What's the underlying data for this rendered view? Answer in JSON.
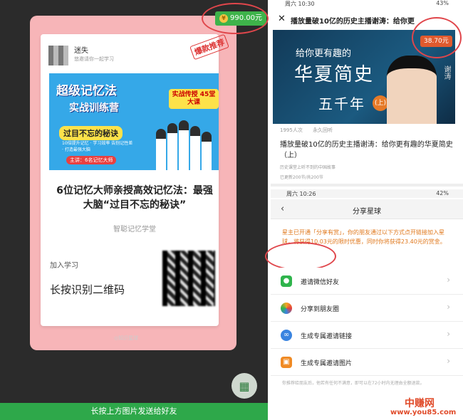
{
  "left_panel": {
    "reward": {
      "amount": "990.00元",
      "coin_icon": "yen-coin-icon"
    },
    "card": {
      "username": "迷失",
      "invite_text": "悠邀请你一起学习",
      "stamp": "爆款推荐",
      "banner": {
        "title1": "超级记忆法",
        "title2": "实战训练营",
        "tag": "实战传授 45堂大课",
        "slogan": "过目不忘的秘诀",
        "desc": "10倍提升记忆 · 学习效率 告别记性差 · 打造最强大脑",
        "host": "主讲：6名记忆大师"
      },
      "title": "6位记忆大师亲授高效记忆法：最强大脑“过目不忘的秘诀”",
      "publisher": "智聪记忆学堂",
      "join_label": "加入学习",
      "long_press": "长按识别二维码",
      "footer_brand": "◎知识星球"
    },
    "qr_button_icon": "qr-code-icon",
    "bottom_bar": "长按上方图片发送给好友"
  },
  "right_panel": {
    "status_top": {
      "time": "周六 10:30",
      "battery": "43%"
    },
    "header_title": "播放量破10亿的历史主播谢涛：给你更",
    "video": {
      "line1": "给你更有趣的",
      "line2": "华夏简史",
      "line3": "五千年",
      "part": "(上)",
      "presenter": "谢涛"
    },
    "price": "38.70元",
    "meta": {
      "views": "1995人次",
      "validity": "永久回听"
    },
    "course_title": "播放量破10亿的历史主播谢涛：给你更有趣的华夏简史（上）",
    "course_sub": "历史课堂上听不到的中国故事",
    "course_update": "已更新200节/共200节",
    "status_mid": {
      "time": "周六 10:26",
      "battery": "42%"
    },
    "nav_title": "分享星球",
    "notice": "星主已开通「分享有赏」，你的朋友通过以下方式点开链接加入星球，将获得10.03元的限时优惠，同时你将获得23.40元的赏金。",
    "menu": [
      {
        "label": "邀请微信好友",
        "icon": "wechat-icon",
        "color": "#2fb44c"
      },
      {
        "label": "分享到朋友圈",
        "icon": "moments-icon",
        "color": "#f4a623"
      },
      {
        "label": "生成专属邀请链接",
        "icon": "link-icon",
        "color": "#3a84e0"
      },
      {
        "label": "生成专属邀请图片",
        "icon": "image-icon",
        "color": "#f08a24"
      }
    ],
    "footer": "你推荐给朋友后，他若有任何不满意，即可以在72小时内无理由全额退款。"
  },
  "watermark": {
    "brand": "中赚网",
    "url": "www.you85.com"
  },
  "colors": {
    "accent_green": "#2ea84a",
    "highlight_red": "#e0464b",
    "notice_orange": "#e0781c"
  }
}
